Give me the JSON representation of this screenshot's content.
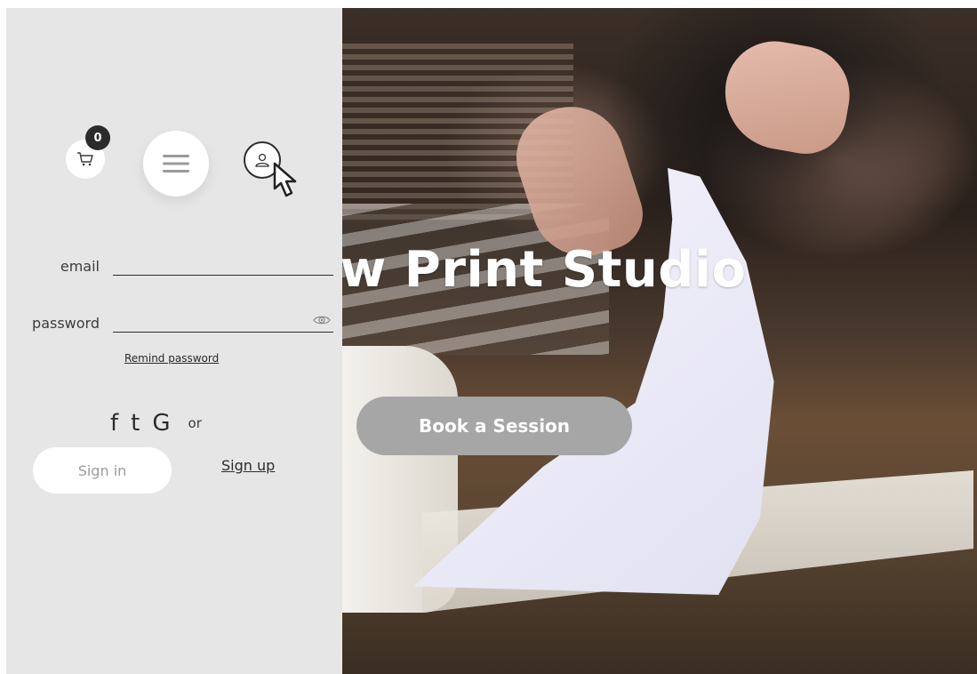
{
  "hero": {
    "title": "gow Print Studio",
    "cta_label": "Book a Session"
  },
  "header": {
    "cart_count": "0",
    "icons": [
      "cart-icon",
      "menu-icon",
      "user-icon",
      "cursor-icon"
    ]
  },
  "login": {
    "email_label": "email",
    "email_value": "",
    "password_label": "password",
    "password_value": "",
    "remind_label": "Remind password",
    "social": {
      "facebook": "f",
      "tumblr": "t",
      "google": "G",
      "or_label": "or"
    },
    "signin_label": "Sign in",
    "signup_label": "Sign up"
  },
  "colors": {
    "panel_bg": "#e6e6e6",
    "button_gray": "#a6a6a6",
    "badge": "#2b2b2b",
    "text_dark": "#2c2c2c"
  }
}
